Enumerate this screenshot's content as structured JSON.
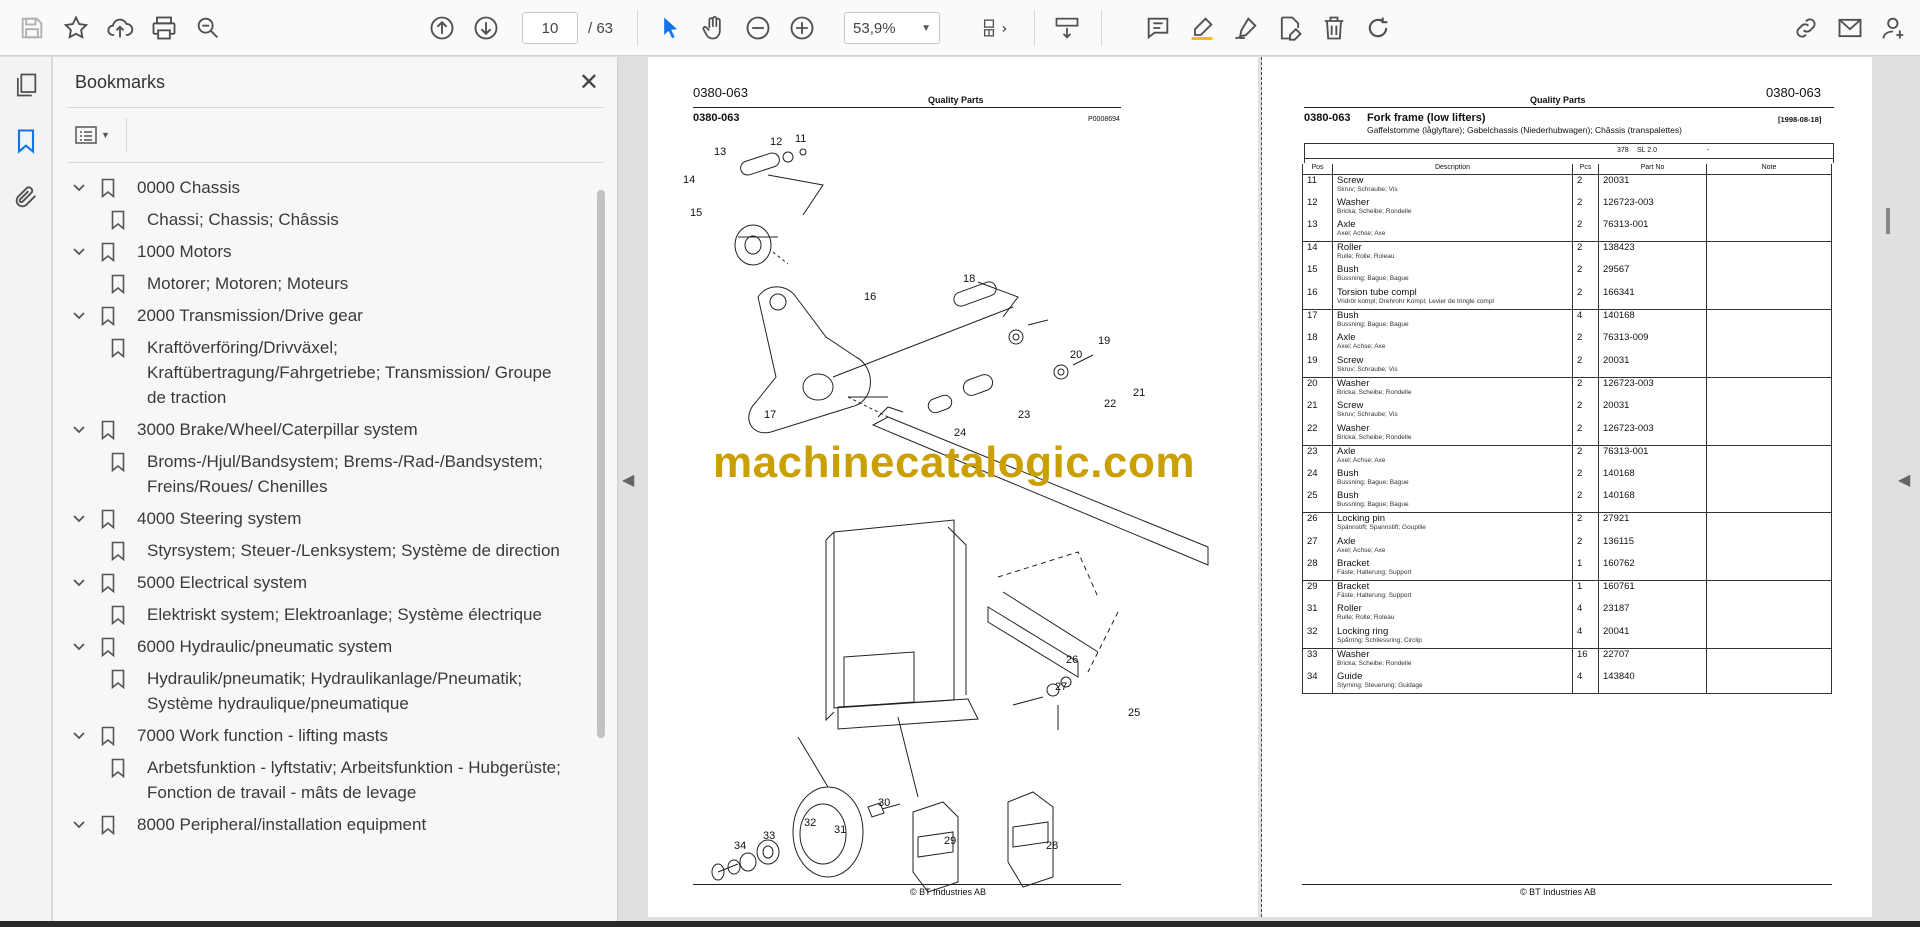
{
  "toolbar": {
    "page_current": "10",
    "page_total": "/ 63",
    "zoom": "53,9%"
  },
  "bookmarks": {
    "title": "Bookmarks",
    "items": [
      {
        "label": "0000 Chassis",
        "level": 0
      },
      {
        "label": "Chassi; Chassis; Châssis",
        "level": 1
      },
      {
        "label": "1000 Motors",
        "level": 0
      },
      {
        "label": "Motorer; Motoren; Moteurs",
        "level": 1
      },
      {
        "label": "2000 Transmission/Drive gear",
        "level": 0
      },
      {
        "label": "Kraftöverföring/Drivväxel; Kraftübertragung/Fahrgetriebe; Transmission/ Groupe de traction",
        "level": 1
      },
      {
        "label": "3000 Brake/Wheel/Caterpillar system",
        "level": 0
      },
      {
        "label": "Broms-/Hjul/Bandsystem; Brems-/Rad-/Bandsystem; Freins/Roues/ Chenilles",
        "level": 1
      },
      {
        "label": "4000 Steering system",
        "level": 0
      },
      {
        "label": "Styrsystem; Steuer-/Lenksystem; Système de direction",
        "level": 1
      },
      {
        "label": "5000 Electrical system",
        "level": 0
      },
      {
        "label": "Elektriskt system; Elektroanlage; Système électrique",
        "level": 1
      },
      {
        "label": "6000 Hydraulic/pneumatic system",
        "level": 0
      },
      {
        "label": "Hydraulik/pneumatik; Hydraulikanlage/Pneumatik; Système hydraulique/pneumatique",
        "level": 1
      },
      {
        "label": "7000 Work function - lifting masts",
        "level": 0
      },
      {
        "label": "Arbetsfunktion - lyftstativ; Arbeitsfunktion - Hubgerüste; Fonction de travail - mâts de levage",
        "level": 1
      },
      {
        "label": "8000 Peripheral/installation equipment",
        "level": 0
      }
    ]
  },
  "page_left": {
    "code_top": "0380-063",
    "header_title": "Quality Parts",
    "code_sub": "0380-063",
    "drawing_no": "P0008694",
    "labels": [
      "11",
      "12",
      "13",
      "14",
      "15",
      "16",
      "17",
      "18",
      "19",
      "20",
      "21",
      "22",
      "23",
      "24",
      "25",
      "26",
      "27",
      "28",
      "29",
      "30",
      "31",
      "32",
      "33",
      "34"
    ],
    "footer": "© BT Industries AB"
  },
  "page_right": {
    "code_top": "0380-063",
    "header_title": "Quality Parts",
    "code_sub": "0380-063",
    "section_title": "Fork frame (low lifters)",
    "section_sub": "Gaffelstomme (låglyftare); Gabelchassis (Niederhubwagen); Châssis (transpalettes)",
    "date": "[1998-08-18]",
    "model_row": [
      "378",
      "SL 2.0",
      "-"
    ],
    "columns": [
      "Pos",
      "Description",
      "Pcs",
      "Part No",
      "Note"
    ],
    "rows": [
      {
        "pos": "11",
        "desc": "Screw",
        "sub": "Skruv; Schraube; Vis",
        "pcs": "2",
        "part": "20031",
        "end": false
      },
      {
        "pos": "12",
        "desc": "Washer",
        "sub": "Bricka; Scheibe; Rondelle",
        "pcs": "2",
        "part": "126723-003",
        "end": false
      },
      {
        "pos": "13",
        "desc": "Axle",
        "sub": "Axel; Achse; Axe",
        "pcs": "2",
        "part": "76313-001",
        "end": true
      },
      {
        "pos": "14",
        "desc": "Roller",
        "sub": "Rulle; Rolle; Roleau",
        "pcs": "2",
        "part": "138423",
        "end": false
      },
      {
        "pos": "15",
        "desc": "Bush",
        "sub": "Bussning; Bague; Bague",
        "pcs": "2",
        "part": "29567",
        "end": false
      },
      {
        "pos": "16",
        "desc": "Torsion tube compl",
        "sub": "Vridrör kompl; Drehrohr Kompl; Levier de tringle compl",
        "pcs": "2",
        "part": "166341",
        "end": true
      },
      {
        "pos": "17",
        "desc": "Bush",
        "sub": "Bussning; Bague; Bague",
        "pcs": "4",
        "part": "140168",
        "end": false
      },
      {
        "pos": "18",
        "desc": "Axle",
        "sub": "Axel; Achse; Axe",
        "pcs": "2",
        "part": "76313-009",
        "end": false
      },
      {
        "pos": "19",
        "desc": "Screw",
        "sub": "Skruv; Schraube; Vis",
        "pcs": "2",
        "part": "20031",
        "end": true
      },
      {
        "pos": "20",
        "desc": "Washer",
        "sub": "Bricka; Scheibe; Rondelle",
        "pcs": "2",
        "part": "126723-003",
        "end": false
      },
      {
        "pos": "21",
        "desc": "Screw",
        "sub": "Skruv; Schraube; Vis",
        "pcs": "2",
        "part": "20031",
        "end": false
      },
      {
        "pos": "22",
        "desc": "Washer",
        "sub": "Bricka; Scheibe; Rondelle",
        "pcs": "2",
        "part": "126723-003",
        "end": true
      },
      {
        "pos": "23",
        "desc": "Axle",
        "sub": "Axel; Achse; Axe",
        "pcs": "2",
        "part": "76313-001",
        "end": false
      },
      {
        "pos": "24",
        "desc": "Bush",
        "sub": "Bussning; Bague; Bague",
        "pcs": "2",
        "part": "140168",
        "end": false
      },
      {
        "pos": "25",
        "desc": "Bush",
        "sub": "Bussning; Bague; Bague",
        "pcs": "2",
        "part": "140168",
        "end": true
      },
      {
        "pos": "26",
        "desc": "Locking pin",
        "sub": "Spännstift; Spannstift; Goupille",
        "pcs": "2",
        "part": "27921",
        "end": false
      },
      {
        "pos": "27",
        "desc": "Axle",
        "sub": "Axel; Achse; Axe",
        "pcs": "2",
        "part": "136115",
        "end": false
      },
      {
        "pos": "28",
        "desc": "Bracket",
        "sub": "Fäste; Halterung; Support",
        "pcs": "1",
        "part": "160762",
        "end": true
      },
      {
        "pos": "29",
        "desc": "Bracket",
        "sub": "Fäste; Halterung; Support",
        "pcs": "1",
        "part": "160761",
        "end": false
      },
      {
        "pos": "31",
        "desc": "Roller",
        "sub": "Rulle; Rolle; Roleau",
        "pcs": "4",
        "part": "23187",
        "end": false
      },
      {
        "pos": "32",
        "desc": "Locking ring",
        "sub": "Spårring; Schliessring; Circlip",
        "pcs": "4",
        "part": "20041",
        "end": true
      },
      {
        "pos": "33",
        "desc": "Washer",
        "sub": "Bricka; Scheibe; Rondelle",
        "pcs": "16",
        "part": "22707",
        "end": false
      },
      {
        "pos": "34",
        "desc": "Guide",
        "sub": "Styrning; Steuerung; Guidage",
        "pcs": "4",
        "part": "143840",
        "end": true
      }
    ],
    "footer": "© BT Industries AB"
  },
  "watermark": "machinecatalogic.com",
  "colors": {
    "watermark": "#c9a000",
    "accent": "#1473e6"
  }
}
